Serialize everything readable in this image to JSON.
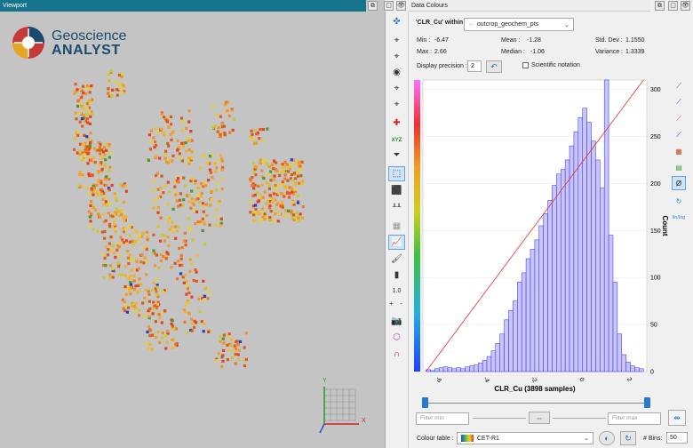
{
  "viewport": {
    "title": "Viewport",
    "logo_line1": "Geoscience",
    "logo_line2": "ANALYST",
    "axis_labels": {
      "x": "X",
      "y": "Y"
    }
  },
  "toolbar": {
    "zoom_value": "1.0",
    "plus": "+",
    "minus": "-",
    "xyz_label": "XYZ"
  },
  "data_colours": {
    "title": "Data Colours",
    "variable_label": "'CLR_Cu' within",
    "object_name": "outcrop_geochem_pts",
    "stats": {
      "min_label": "Min :",
      "min_value": "-6.47",
      "max_label": "Max :",
      "max_value": "2.66",
      "mean_label": "Mean :",
      "mean_value": "-1.28",
      "median_label": "Median :",
      "median_value": "-1.06",
      "std_label": "Std. Dev :",
      "std_value": "1.1550",
      "var_label": "Variance :",
      "var_value": "1.3339"
    },
    "precision_label": "Display precision :",
    "precision_value": "2",
    "scientific_label": "Scientific notation",
    "filter_min_placeholder": "Filter min",
    "filter_max_placeholder": "Filter max",
    "colour_table_label": "Colour table :",
    "colour_table_value": "CET-R1",
    "bins_label": "# Bins:",
    "bins_value": "50",
    "log_toggle": "lin/log"
  },
  "chart_data": {
    "type": "bar",
    "xlabel": "CLR_Cu (3898 samples)",
    "ylabel": "Count",
    "xlim": [
      -6.6,
      2.8
    ],
    "ylim": [
      0,
      310
    ],
    "xticks": [
      -6,
      -4,
      -2,
      0,
      2
    ],
    "yticks": [
      0,
      50,
      100,
      150,
      200,
      250,
      300
    ],
    "bin_start": -6.47,
    "bin_width": 0.1826,
    "values": [
      2,
      1,
      3,
      4,
      5,
      4,
      3,
      4,
      3,
      5,
      6,
      7,
      9,
      12,
      16,
      22,
      30,
      40,
      55,
      65,
      75,
      95,
      105,
      120,
      130,
      140,
      155,
      168,
      182,
      198,
      210,
      215,
      225,
      240,
      255,
      270,
      280,
      265,
      245,
      225,
      195,
      310,
      145,
      95,
      40,
      18,
      10,
      6,
      4,
      3
    ],
    "cumulative_line": true,
    "colors": {
      "bar_fill": "#c9c6f5",
      "bar_stroke": "#2a2aff",
      "cum_line": "#e83030"
    }
  }
}
